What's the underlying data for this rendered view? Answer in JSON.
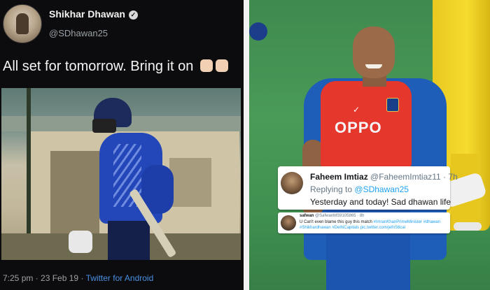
{
  "tweet": {
    "author_name": "Shikhar Dhawan",
    "verified_symbol": "✓",
    "handle": "@SDhawan25",
    "text": "All set for tomorrow. Bring it on",
    "time": "7:25 pm",
    "date": "23 Feb 19",
    "dot": "·",
    "app": "Twitter for Android"
  },
  "jersey": {
    "sponsor": "OPPO",
    "swoosh": "✓"
  },
  "reply": {
    "name": "Faheem Imtiaz",
    "handle": "@FaheemImtiaz11",
    "time": "7h",
    "replying_prefix": "Replying to",
    "replying_handle": "@SDhawan25",
    "text": "Yesterday and today! Sad dhawan life"
  },
  "reply2": {
    "name": "safwan",
    "handle": "@SafwanMS9105865",
    "time": "8h",
    "line1_text": "U Can't even blame this guy this match",
    "line1_tag1": "#ImranKhanPrimeMinister",
    "line1_tag2": "#dhawan",
    "line2_tag1": "#Shikhardhawan",
    "line2_tag2": "#DelhiCapitals",
    "line2_link": "pic.twitter.com/jefnS6cai"
  }
}
